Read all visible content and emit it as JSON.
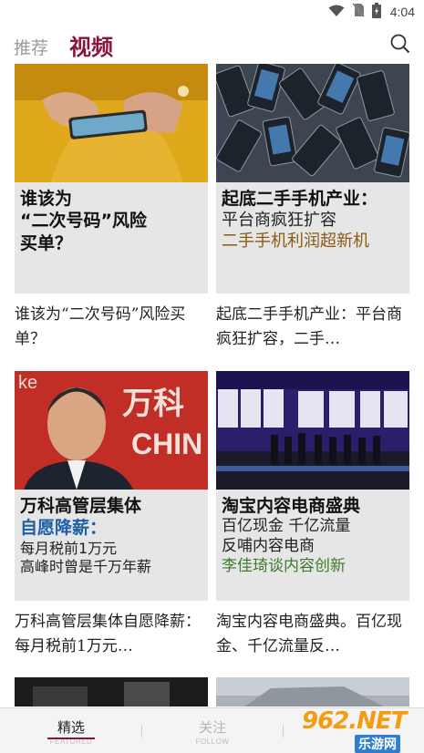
{
  "status_bar": {
    "time": "4:04",
    "icons": [
      "wifi-icon",
      "no-sim-icon",
      "battery-icon"
    ]
  },
  "top_nav": {
    "tabs": [
      {
        "label": "推荐",
        "active": false
      },
      {
        "label": "视频",
        "active": true
      }
    ],
    "search_icon": "search-icon"
  },
  "colors": {
    "accent": "#8a1538",
    "overlay_bg": "#e6e6e6",
    "highlight_brown": "#8a5a12",
    "highlight_blue": "#1f5fa8",
    "highlight_green": "#3f7a2a"
  },
  "cards": [
    {
      "overlay_lines": [
        "谁该为",
        "“二次号码”风险",
        "买单？"
      ],
      "caption": "谁该为“二次号码”风险买单？"
    },
    {
      "overlay_lines": [
        "起底二手手机产业：",
        "平台商疯狂扩容",
        "二手手机利润超新机"
      ],
      "caption": "起底二手手机产业：平台商疯狂扩容，二手…"
    },
    {
      "overlay_lines": [
        "万科高管层集体",
        "自愿降薪：",
        "每月税前1万元",
        "高峰时曾是千万年薪"
      ],
      "caption": "万科高管层集体自愿降薪： 每月税前1万元…",
      "photo_text": [
        "万科",
        "CHIN",
        "ke"
      ]
    },
    {
      "overlay_lines": [
        "淘宝内容电商盛典",
        "百亿现金 千亿流量",
        "反哺内容电商",
        "李佳琦谈内容创新"
      ],
      "caption": "淘宝内容电商盛典。百亿现金、千亿流量反…"
    }
  ],
  "bottom_nav": [
    {
      "label": "精选",
      "sub": "FEATURED",
      "active": true
    },
    {
      "label": "关注",
      "sub": "FOLLOW",
      "active": false
    }
  ],
  "watermark": {
    "number": "962.NET",
    "sub": "乐游网"
  }
}
